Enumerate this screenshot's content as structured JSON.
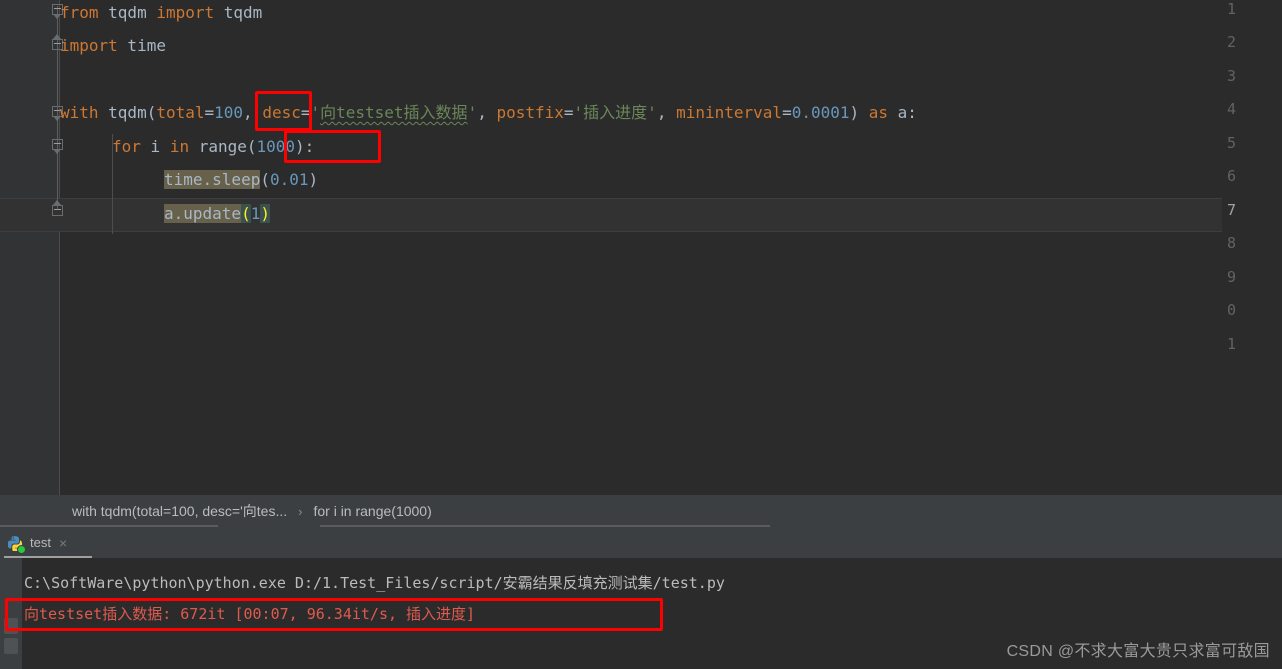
{
  "editor": {
    "line_numbers": [
      "1",
      "2",
      "3",
      "4",
      "5",
      "6",
      "7",
      "8",
      "9",
      "0",
      "1"
    ],
    "current_line": "7",
    "lines": [
      {
        "n": "1",
        "tokens": [
          {
            "t": "from",
            "c": "kw"
          },
          {
            "t": " tqdm ",
            "c": "plain"
          },
          {
            "t": "import",
            "c": "kw"
          },
          {
            "t": " tqdm",
            "c": "plain"
          }
        ]
      },
      {
        "n": "2",
        "tokens": [
          {
            "t": "import",
            "c": "kw"
          },
          {
            "t": " time",
            "c": "plain"
          }
        ]
      },
      {
        "n": "3",
        "tokens": []
      },
      {
        "n": "4",
        "tokens": [
          {
            "t": "with",
            "c": "kw"
          },
          {
            "t": " tqdm(",
            "c": "plain"
          },
          {
            "t": "total",
            "c": "named"
          },
          {
            "t": "=",
            "c": "plain"
          },
          {
            "t": "100",
            "c": "num"
          },
          {
            "t": ", ",
            "c": "plain"
          },
          {
            "t": "desc",
            "c": "named"
          },
          {
            "t": "=",
            "c": "plain"
          },
          {
            "t": "'向testset插入数据'",
            "c": "str"
          },
          {
            "t": ", ",
            "c": "plain"
          },
          {
            "t": "postfix",
            "c": "named"
          },
          {
            "t": "=",
            "c": "plain"
          },
          {
            "t": "'插入进度'",
            "c": "str"
          },
          {
            "t": ", ",
            "c": "plain"
          },
          {
            "t": "mininterval",
            "c": "named"
          },
          {
            "t": "=",
            "c": "plain"
          },
          {
            "t": "0.0001",
            "c": "num"
          },
          {
            "t": ") ",
            "c": "plain"
          },
          {
            "t": "as",
            "c": "kw"
          },
          {
            "t": " a:",
            "c": "plain"
          }
        ]
      },
      {
        "n": "5",
        "tokens": [
          {
            "t": "for",
            "c": "kw"
          },
          {
            "t": " i ",
            "c": "plain"
          },
          {
            "t": "in",
            "c": "kw"
          },
          {
            "t": " range",
            "c": "plain"
          },
          {
            "t": "(",
            "c": "plain"
          },
          {
            "t": "1000",
            "c": "num"
          },
          {
            "t": "):",
            "c": "plain"
          }
        ]
      },
      {
        "n": "6",
        "tokens": [
          {
            "t": "time.sleep",
            "c": "plain"
          },
          {
            "t": "(",
            "c": "plain"
          },
          {
            "t": "0.01",
            "c": "num"
          },
          {
            "t": ")",
            "c": "plain"
          }
        ]
      },
      {
        "n": "7",
        "tokens": [
          {
            "t": "a.update",
            "c": "plain"
          },
          {
            "t": "(",
            "c": "brace"
          },
          {
            "t": "1",
            "c": "num"
          },
          {
            "t": ")",
            "c": "brace"
          }
        ]
      }
    ],
    "raw_line_1": "from tqdm import tqdm",
    "raw_line_2": "import time",
    "raw_line_4": "with tqdm(total=100, desc='向testset插入数据', postfix='插入进度', mininterval=0.0001) as a:",
    "raw_line_5": "for i in range(1000):",
    "raw_line_6": "time.sleep(0.01)",
    "raw_line_7": "a.update(1)"
  },
  "breadcrumb": {
    "crumb1": "with tqdm(total=100, desc='向tes...",
    "separator": "›",
    "crumb2": "for i in range(1000)"
  },
  "run_window": {
    "tab_label": "test",
    "tab_icon": "python-icon",
    "close_icon": "×",
    "console_lines": [
      {
        "id": "command",
        "text": "C:\\SoftWare\\python\\python.exe D:/1.Test_Files/script/安霸结果反填充测试集/test.py",
        "style": "path"
      },
      {
        "id": "tqdm-output",
        "text": "向testset插入数据: 672it [00:07, 96.34it/s, 插入进度]",
        "style": "out"
      }
    ]
  },
  "annotations": {
    "highlight_color": "#fe0000",
    "boxes": [
      {
        "id": "total-100",
        "label": "100,"
      },
      {
        "id": "range-1000",
        "label": "(1000):"
      },
      {
        "id": "tqdm-progress-output",
        "label": "向testset插入数据: 672it [00:07, 96.34it/s, 插入进度]"
      }
    ]
  },
  "watermark": {
    "text": "CSDN @不求大富大贵只求富可敌国"
  },
  "colors": {
    "editor_bg": "#2b2b2b",
    "gutter_bg": "#313335",
    "panel_bg": "#3c3f41",
    "keyword": "#cc7832",
    "number": "#6897bb",
    "string": "#6a8759",
    "text": "#a9b7c6",
    "console_output": "#e05a4e",
    "annotation": "#fe0000"
  }
}
